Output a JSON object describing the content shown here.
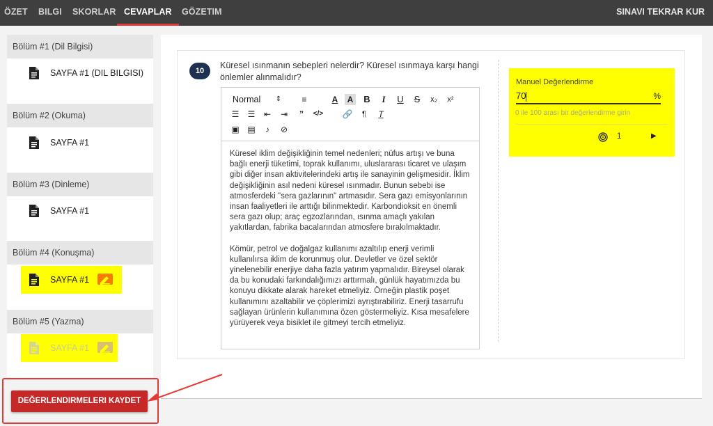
{
  "tabs": [
    {
      "label": "ÖZET"
    },
    {
      "label": "BILGI"
    },
    {
      "label": "SKORLAR"
    },
    {
      "label": "CEVAPLAR"
    },
    {
      "label": "GÖZETIM"
    }
  ],
  "retake_label": "SINAVI TEKRAR KUR",
  "sidebar": {
    "sections": [
      {
        "title": "Bölüm #1 (Dil Bilgisi)",
        "page": "SAYFA #1 (DIL BILGISI)"
      },
      {
        "title": "Bölüm #2 (Okuma)",
        "page": "SAYFA #1"
      },
      {
        "title": "Bölüm #3 (Dinleme)",
        "page": "SAYFA #1"
      },
      {
        "title": "Bölüm #4 (Konuşma)",
        "page": "SAYFA #1"
      },
      {
        "title": "Bölüm #5 (Yazma)",
        "page": "SAYFA #1"
      }
    ]
  },
  "question": {
    "number": "10",
    "text": "Küresel ısınmanın sebepleri nelerdir?  Küresel ısınmaya karşı hangi önlemler alınmalıdır?",
    "format_select": "Normal",
    "answer_p1": "Küresel iklim değişikliğinin temel nedenleri; nüfus artışı ve buna bağlı enerji tüketimi, toprak kullanımı, uluslararası ticaret ve ulaşım gibi diğer insan aktivitelerindeki artış ile sanayinin gelişmesidir. İklim değişikliğinin asıl nedeni küresel ısınmadır. Bunun sebebi ise atmosferdeki \"sera gazlarının\" artmasıdır. Sera gazı emisyonlarının insan faaliyetleri ile arttığı bilinmektedir. Karbondioksit en önemli sera gazı olup; araç egzozlarından, ısınma amaçlı yakılan yakıtlardan, fabrika bacalarından atmosfere bırakılmaktadır.",
    "answer_p2": "Kömür, petrol ve doğalgaz kullanımı azaltılıp enerji verimli kullanılırsa iklim de korunmuş olur. Devletler ve özel sektör yinelenebilir enerjiye daha fazla yatırım yapmalıdır. Bireysel olarak da bu konudaki farkındalığımızı arttırmalı, günlük hayatımızda bu konuyu dikkate alarak hareket etmeliyiz. Örneğin plastik poşet kullanımını azaltabilir ve çöplerimizi ayrıştırabiliriz. Enerji tasarrufu sağlayan ürünlerin kullanımına özen göstermeliyiz. Kısa mesafelere yürüyerek veya bisiklet ile gitmeyi tercih etmeliyiz."
  },
  "grading": {
    "label": "Manuel Değerlendirme",
    "value": "70",
    "unit": "%",
    "help": "0 ile 100 arası bir değerlendirme girin",
    "count": "1"
  },
  "save_label": "DEĞERLENDIRMELERI KAYDET",
  "colors": {
    "highlight": "#ffff00",
    "accent": "#e53935",
    "save": "#c62828",
    "badge": "#1f3150",
    "flag": "#f57c00"
  }
}
